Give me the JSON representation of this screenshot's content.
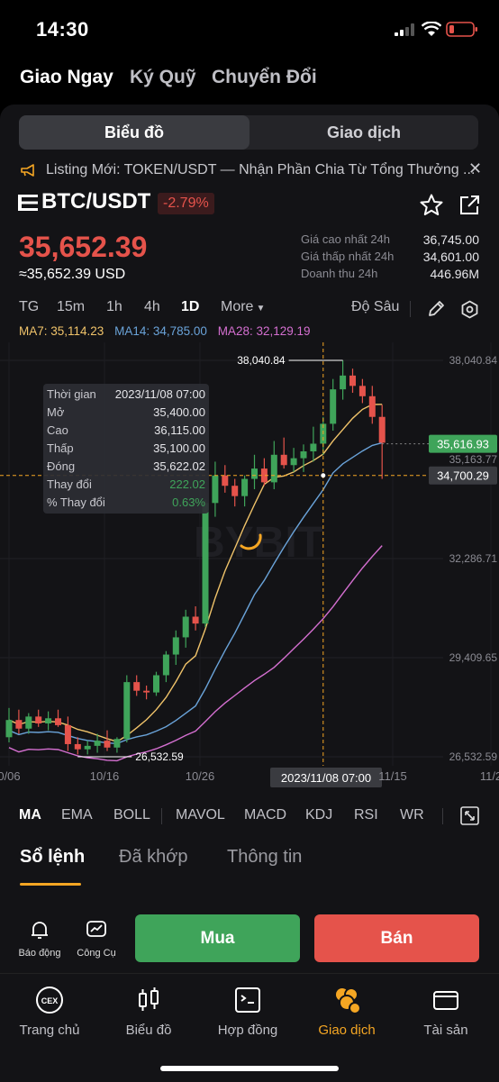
{
  "status": {
    "time": "14:30"
  },
  "top_tabs": [
    "Giao Ngay",
    "Ký Quỹ",
    "Chuyển Đổi"
  ],
  "segment": {
    "chart": "Biểu đồ",
    "trade": "Giao dịch"
  },
  "ticker": "Listing Mới: TOKEN/USDT — Nhận Phần Chia Từ Tổng Thưởng ...",
  "pair": {
    "name": "BTC/USDT",
    "change": "-2.79%"
  },
  "price": {
    "last": "35,652.39",
    "usd": "≈35,652.39 USD"
  },
  "stats": [
    {
      "label": "Giá cao nhất 24h",
      "value": "36,745.00"
    },
    {
      "label": "Giá thấp nhất 24h",
      "value": "34,601.00"
    },
    {
      "label": "Doanh thu 24h",
      "value": "446.96M"
    }
  ],
  "timeframes": [
    "TG",
    "15m",
    "1h",
    "4h",
    "1D",
    "More"
  ],
  "timeframe_selected": "1D",
  "depth_label": "Độ Sâu",
  "ma": {
    "ma7": "MA7: 35,114.23",
    "ma14": "MA14: 34,785.00",
    "ma28": "MA28: 32,129.19"
  },
  "colors": {
    "up": "#3fa45a",
    "down": "#e5534b",
    "ma7": "#f0c36a",
    "ma14": "#6aa3d9",
    "ma28": "#d46fd0",
    "accent": "#f5a623"
  },
  "chart_data": {
    "type": "candlestick",
    "price_axis": [
      "38,040.84",
      "35,163.77",
      "32,286.71",
      "29,409.65",
      "26,532.59"
    ],
    "date_axis": [
      "0/06",
      "10/16",
      "10/26",
      "11/15",
      "11/2"
    ],
    "high_marker": "38,040.84",
    "low_marker": "26,532.59",
    "current_price_tag": "35,616.93",
    "crosshair_price_tag": "34,700.29",
    "crosshair_date": "2023/11/08 07:00",
    "ylim": [
      26532.59,
      38040.84
    ],
    "candles": [
      [
        27100,
        27950,
        26950,
        27600
      ],
      [
        27600,
        27900,
        27200,
        27350
      ],
      [
        27350,
        27800,
        27200,
        27700
      ],
      [
        27700,
        27900,
        27400,
        27500
      ],
      [
        27500,
        27850,
        27300,
        27650
      ],
      [
        27650,
        27900,
        27400,
        27450
      ],
      [
        27450,
        27700,
        26700,
        26900
      ],
      [
        26900,
        27100,
        26600,
        26750
      ],
      [
        26750,
        27000,
        26600,
        26850
      ],
      [
        26850,
        27200,
        26650,
        27000
      ],
      [
        27000,
        27300,
        26700,
        26800
      ],
      [
        26800,
        27100,
        26650,
        27050
      ],
      [
        27050,
        28900,
        26950,
        28700
      ],
      [
        28700,
        28900,
        28300,
        28450
      ],
      [
        28450,
        28600,
        28200,
        28400
      ],
      [
        28400,
        29000,
        28300,
        28900
      ],
      [
        28900,
        29600,
        28700,
        29500
      ],
      [
        29500,
        30200,
        29200,
        30000
      ],
      [
        30000,
        30800,
        29700,
        30600
      ],
      [
        30600,
        30900,
        30200,
        30400
      ],
      [
        30400,
        34000,
        30300,
        33900
      ],
      [
        33900,
        35100,
        33500,
        34700
      ],
      [
        34700,
        35000,
        34200,
        34400
      ],
      [
        34400,
        34600,
        33800,
        34100
      ],
      [
        34100,
        34700,
        33800,
        34600
      ],
      [
        34600,
        35300,
        34300,
        34900
      ],
      [
        34900,
        35200,
        34400,
        34500
      ],
      [
        34500,
        35700,
        34300,
        35300
      ],
      [
        35300,
        35800,
        34900,
        35000
      ],
      [
        35000,
        35500,
        34800,
        35200
      ],
      [
        35200,
        35600,
        34800,
        35400
      ],
      [
        35400,
        36115,
        35100,
        35622
      ],
      [
        35622,
        36400,
        35300,
        36200
      ],
      [
        36200,
        37500,
        36000,
        37200
      ],
      [
        37200,
        38040,
        36900,
        37600
      ],
      [
        37600,
        37800,
        37100,
        37300
      ],
      [
        37300,
        37500,
        36800,
        37000
      ],
      [
        37000,
        37300,
        36200,
        36400
      ],
      [
        36400,
        36750,
        34600,
        35650
      ]
    ]
  },
  "tooltip": [
    {
      "k": "Thời gian",
      "v": "2023/11/08 07:00"
    },
    {
      "k": "Mở",
      "v": "35,400.00"
    },
    {
      "k": "Cao",
      "v": "36,115.00"
    },
    {
      "k": "Thấp",
      "v": "35,100.00"
    },
    {
      "k": "Đóng",
      "v": "35,622.02"
    },
    {
      "k": "Thay đổi",
      "v": "222.02"
    },
    {
      "k": "% Thay đổi",
      "v": "0.63%"
    }
  ],
  "indicators": [
    "MA",
    "EMA",
    "BOLL",
    "MAVOL",
    "MACD",
    "KDJ",
    "RSI",
    "WR"
  ],
  "book_tabs": [
    "Sổ lệnh",
    "Đã khớp",
    "Thông tin"
  ],
  "actions": {
    "alert": "Báo động",
    "tools": "Công Cụ",
    "buy": "Mua",
    "sell": "Bán"
  },
  "nav": [
    {
      "label": "Trang chủ",
      "icon": "cex-icon"
    },
    {
      "label": "Biểu đồ",
      "icon": "candles-icon"
    },
    {
      "label": "Hợp đồng",
      "icon": "contract-icon"
    },
    {
      "label": "Giao dịch",
      "icon": "trade-icon"
    },
    {
      "label": "Tài sản",
      "icon": "wallet-icon"
    }
  ],
  "cex_badge": "CEX"
}
